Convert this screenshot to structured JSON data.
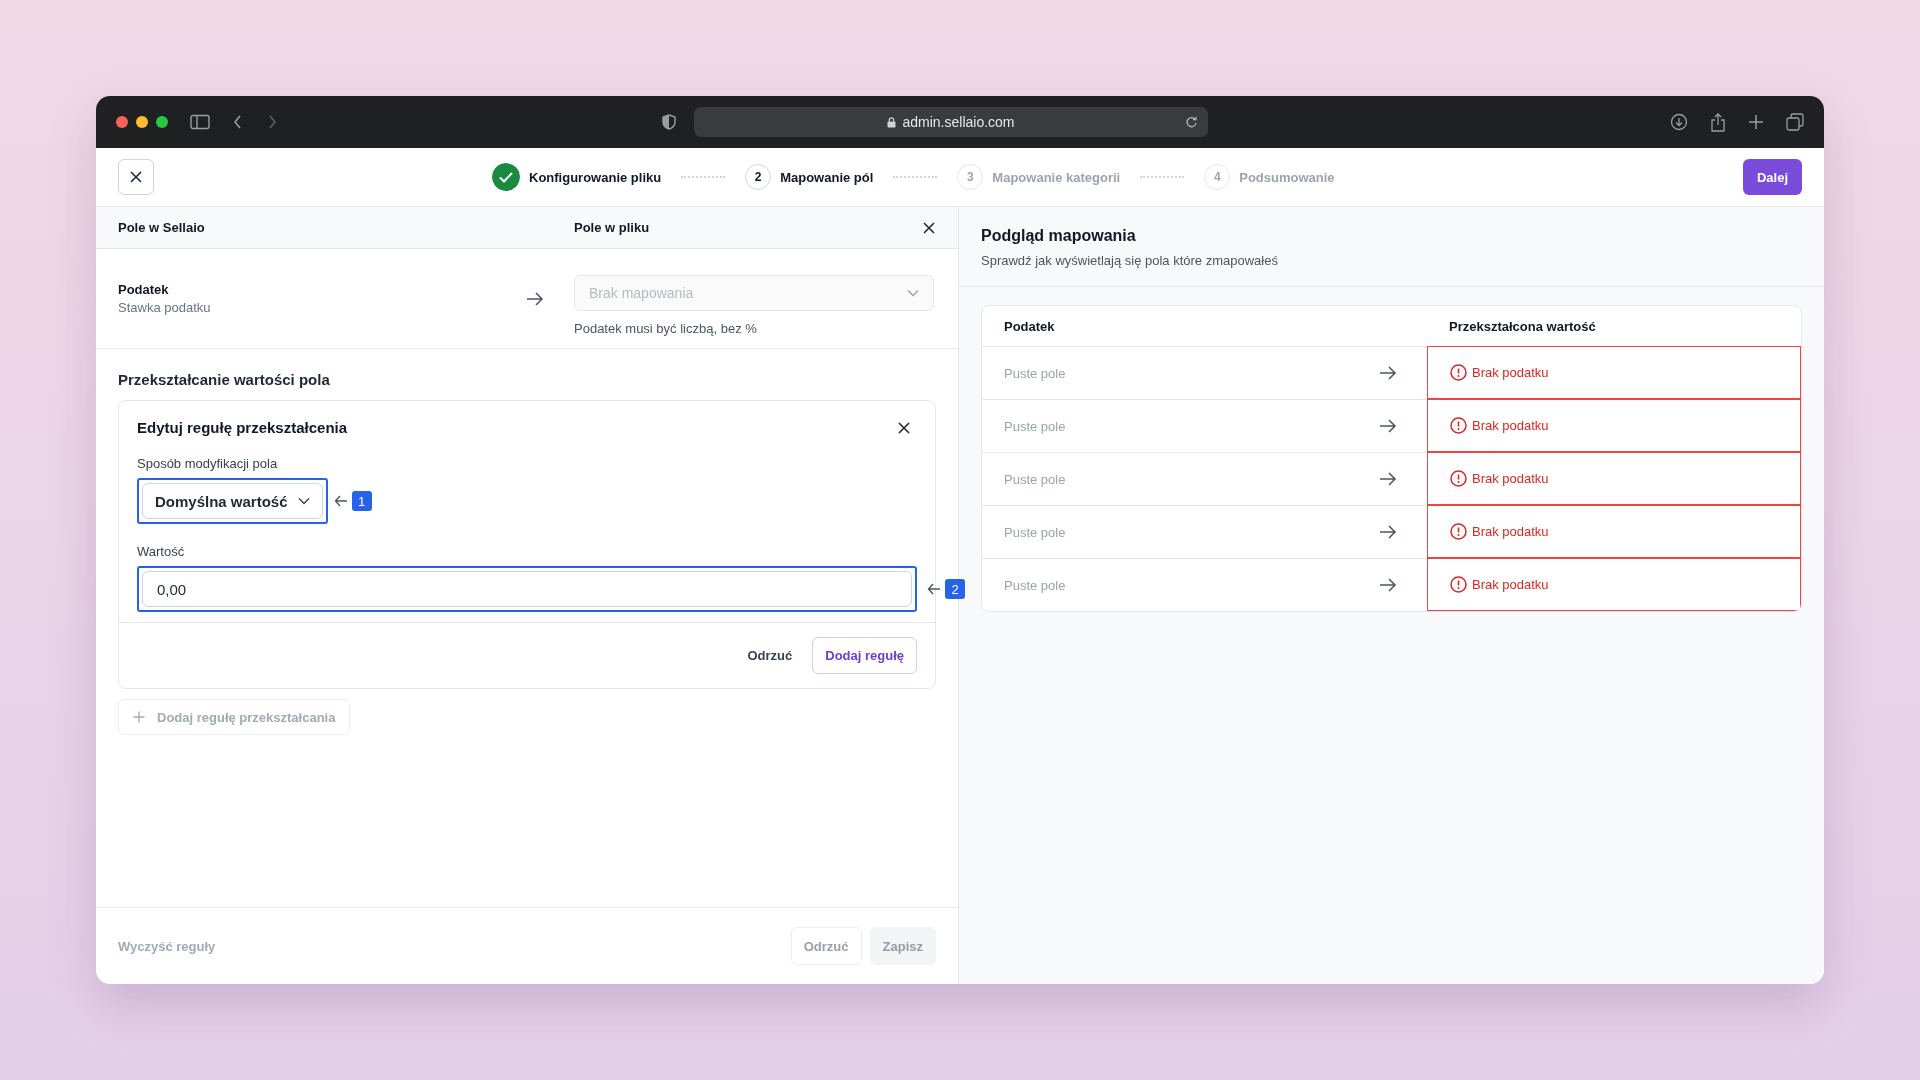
{
  "browser": {
    "url": "admin.sellaio.com"
  },
  "stepper": {
    "steps": [
      {
        "label": "Konfigurowanie pliku",
        "completed": true,
        "selected": false
      },
      {
        "number": "2",
        "label": "Mapowanie pól",
        "completed": false,
        "selected": true
      },
      {
        "number": "3",
        "label": "Mapowanie kategorii",
        "completed": false,
        "selected": false
      },
      {
        "number": "4",
        "label": "Podsumowanie",
        "completed": false,
        "selected": false
      }
    ],
    "next_button": "Dalej"
  },
  "mapping": {
    "header": {
      "column_1": "Pole w Sellaio",
      "column_2": "Pole w pliku"
    },
    "field": {
      "name": "Podatek",
      "description": "Stawka podatku"
    },
    "file_field": {
      "placeholder": "Brak mapowania",
      "disabled": true
    },
    "hint": "Podatek musi być liczbą, bez %"
  },
  "transform": {
    "title": "Przekształcanie wartości pola",
    "rule_editor": {
      "title": "Edytuj regułę przekształcenia",
      "method_label": "Sposób modyfikacji pola",
      "method_value": "Domyślna wartość",
      "method_callout": "1",
      "value_label": "Wartość",
      "value": "0,00",
      "value_callout": "2",
      "cancel": "Odrzuć",
      "submit": "Dodaj regułę"
    },
    "add_rule": {
      "label": "Dodaj regułę przekształcania",
      "disabled": true
    }
  },
  "footer": {
    "clear": {
      "label": "Wyczyść reguły",
      "disabled": true
    },
    "buttons": [
      {
        "label": "Odrzuć",
        "kind": "secondary",
        "disabled": true
      },
      {
        "label": "Zapisz",
        "kind": "primary",
        "disabled": true
      }
    ]
  },
  "preview": {
    "title": "Podgląd mapowania",
    "subtitle": "Sprawdź jak wyświetlają się pola które zmapowałeś",
    "table": {
      "columns": [
        "Podatek",
        "Przekształcona wartość"
      ],
      "rows": [
        {
          "source": "Puste pole",
          "result": "Brak podatku",
          "error": true
        },
        {
          "source": "Puste pole",
          "result": "Brak podatku",
          "error": true
        },
        {
          "source": "Puste pole",
          "result": "Brak podatku",
          "error": true
        },
        {
          "source": "Puste pole",
          "result": "Brak podatku",
          "error": true
        },
        {
          "source": "Puste pole",
          "result": "Brak podatku",
          "error": true
        }
      ]
    }
  }
}
